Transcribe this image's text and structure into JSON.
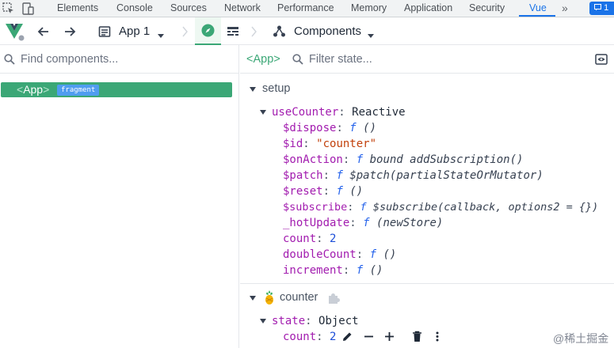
{
  "devtools": {
    "tabs": [
      {
        "label": "Elements"
      },
      {
        "label": "Console"
      },
      {
        "label": "Sources"
      },
      {
        "label": "Network"
      },
      {
        "label": "Performance"
      },
      {
        "label": "Memory"
      },
      {
        "label": "Application"
      },
      {
        "label": "Security"
      },
      {
        "label": "Vue"
      }
    ],
    "active_tab": "Vue",
    "more_label": "»",
    "badge_label": "1",
    "accent_color": "#1a73e8"
  },
  "toolbar": {
    "app_select_label": "App 1",
    "components_label": "Components",
    "brand_color": "#3ba776"
  },
  "left": {
    "search_placeholder": "Find components...",
    "tree": [
      {
        "open_bracket": "<",
        "name": "App",
        "close_bracket": ">",
        "badge": "fragment",
        "selected": true
      }
    ]
  },
  "right": {
    "component_name": "<App>",
    "filter_placeholder": "Filter state...",
    "setup_section": {
      "title": "setup",
      "object_key": "useCounter",
      "object_type": "Reactive",
      "entries": [
        {
          "key": "$dispose",
          "f": "f",
          "sig": "()"
        },
        {
          "key": "$id",
          "string": "\"counter\""
        },
        {
          "key": "$onAction",
          "f": "f",
          "sig": "bound addSubscription()"
        },
        {
          "key": "$patch",
          "f": "f",
          "sig": "$patch(partialStateOrMutator)"
        },
        {
          "key": "$reset",
          "f": "f",
          "sig": "()"
        },
        {
          "key": "$subscribe",
          "f": "f",
          "sig": "$subscribe(callback, options2 = {})"
        },
        {
          "key": "_hotUpdate",
          "f": "f",
          "sig": "(newStore)"
        },
        {
          "key": "count",
          "number": "2"
        },
        {
          "key": "doubleCount",
          "f": "f",
          "sig": "()"
        },
        {
          "key": "increment",
          "f": "f",
          "sig": "()"
        }
      ]
    },
    "store_section": {
      "title": "counter",
      "state_key": "state",
      "state_type": "Object",
      "entries": [
        {
          "key": "count",
          "number": "2"
        }
      ]
    }
  },
  "watermark": "@稀土掘金"
}
